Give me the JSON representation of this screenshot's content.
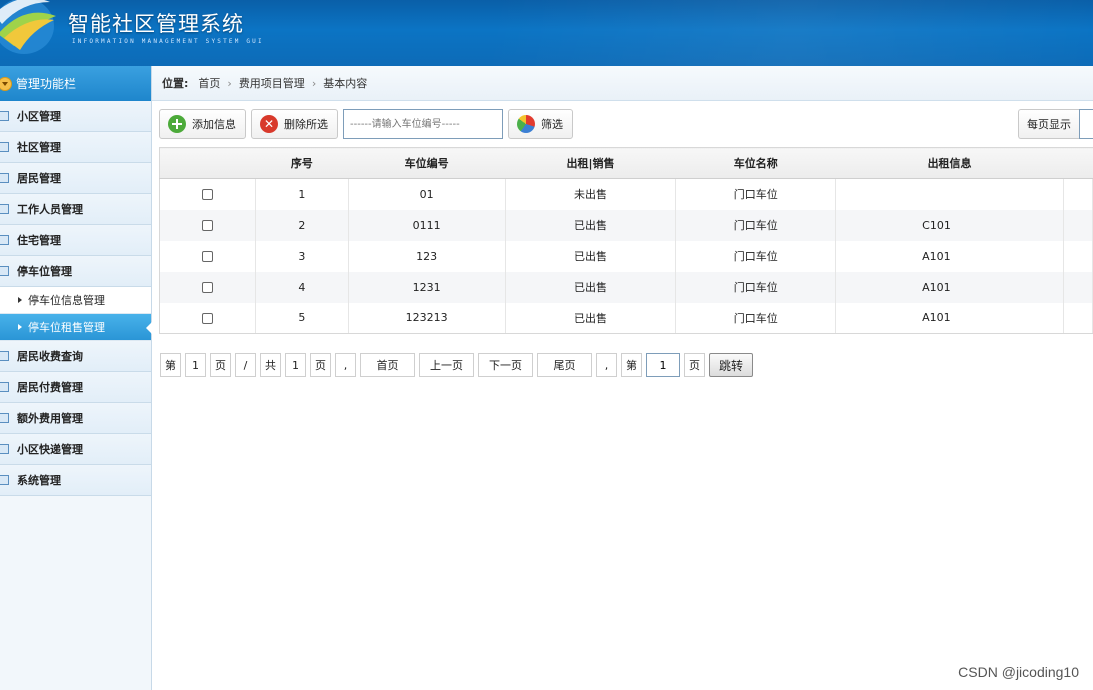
{
  "header": {
    "title": "智能社区管理系统",
    "subtitle": "INFORMATION MANAGEMENT SYSTEM GUI"
  },
  "sidebar": {
    "head": "管理功能栏",
    "items": [
      {
        "label": "小区管理"
      },
      {
        "label": "社区管理"
      },
      {
        "label": "居民管理"
      },
      {
        "label": "工作人员管理"
      },
      {
        "label": "住宅管理"
      },
      {
        "label": "停车位管理"
      }
    ],
    "subitems": [
      {
        "label": "停车位信息管理"
      },
      {
        "label": "停车位租售管理"
      }
    ],
    "items_after": [
      {
        "label": "居民收费查询"
      },
      {
        "label": "居民付费管理"
      },
      {
        "label": "额外费用管理"
      },
      {
        "label": "小区快递管理"
      },
      {
        "label": "系统管理"
      }
    ]
  },
  "breadcrumb": {
    "label": "位置:",
    "items": [
      "首页",
      "费用项目管理",
      "基本内容"
    ]
  },
  "toolbar": {
    "add_label": "添加信息",
    "delete_label": "删除所选",
    "search_placeholder": "------请输入车位编号-----",
    "filter_label": "筛选",
    "per_page_label": "每页显示"
  },
  "table": {
    "headers": [
      "",
      "序号",
      "车位编号",
      "出租|销售",
      "车位名称",
      "出租信息"
    ],
    "rows": [
      {
        "no": "1",
        "code": "01",
        "status": "未出售",
        "name": "门口车位",
        "info": ""
      },
      {
        "no": "2",
        "code": "0111",
        "status": "已出售",
        "name": "门口车位",
        "info": "C101"
      },
      {
        "no": "3",
        "code": "123",
        "status": "已出售",
        "name": "门口车位",
        "info": "A101"
      },
      {
        "no": "4",
        "code": "1231",
        "status": "已出售",
        "name": "门口车位",
        "info": "A101"
      },
      {
        "no": "5",
        "code": "123213",
        "status": "已出售",
        "name": "门口车位",
        "info": "A101"
      }
    ]
  },
  "pager": {
    "di": "第",
    "cur": "1",
    "ye": "页",
    "slash": "/",
    "gong": "共",
    "total": "1",
    "ye2": "页",
    "comma": ",",
    "first": "首页",
    "prev": "上一页",
    "next": "下一页",
    "last": "尾页",
    "comma2": ",",
    "di2": "第",
    "input_value": "1",
    "ye3": "页",
    "go": "跳转"
  },
  "watermark": "CSDN @jicoding10",
  "colors": {
    "status_unsold": "#e0231c",
    "status_sold": "#2d9a2d",
    "header_blue": "#0b74c4",
    "active_menu": "#2a95d6"
  }
}
